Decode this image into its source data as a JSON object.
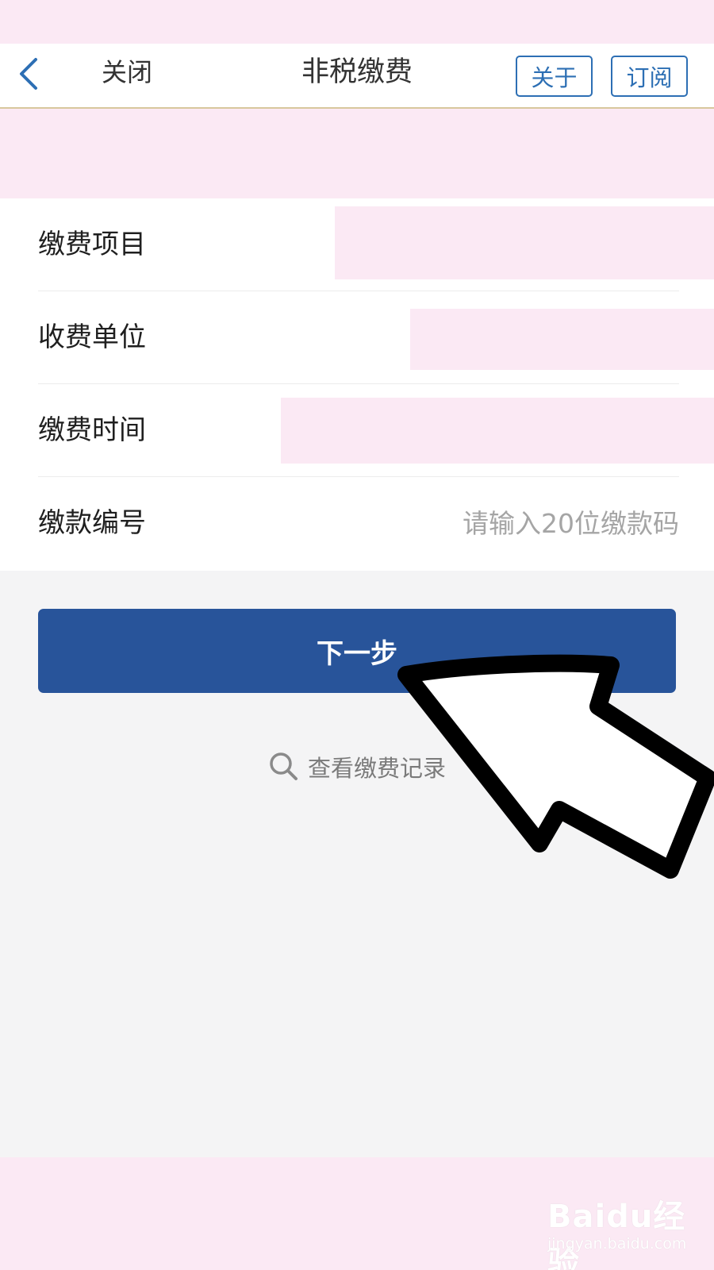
{
  "nav": {
    "close_label": "关闭",
    "title": "非税缴费",
    "about_label": "关于",
    "subscribe_label": "订阅",
    "back_icon": "chevron-left-icon"
  },
  "form": {
    "rows": [
      {
        "label": "缴费项目"
      },
      {
        "label": "收费单位"
      },
      {
        "label": "缴费时间"
      },
      {
        "label": "缴款编号",
        "placeholder": "请输入20位缴款码",
        "value": ""
      }
    ]
  },
  "actions": {
    "next_label": "下一步",
    "records_label": "查看缴费记录",
    "records_icon": "search-icon"
  },
  "watermark": {
    "logo": "Baidu经验",
    "url": "jingyan.baidu.com"
  },
  "colors": {
    "accent": "#2d6fb4",
    "primary_button": "#28549a",
    "redaction": "#fbe9f4",
    "background": "#f4f4f5"
  }
}
